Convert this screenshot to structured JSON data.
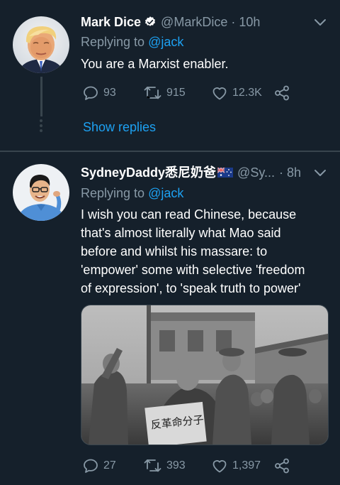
{
  "tweets": [
    {
      "name": "Mark Dice",
      "handle": "@MarkDice",
      "time": "· 10h",
      "replying_prefix": "Replying to",
      "replying_to": "@jack",
      "text": "You are a Marxist enabler.",
      "stats": {
        "replies": "93",
        "retweets": "915",
        "likes": "12.3K"
      },
      "show_replies": "Show replies",
      "verified": true
    },
    {
      "name": "SydneyDaddy悉尼奶爸",
      "handle": "@Sy...",
      "time": "· 8h",
      "replying_prefix": "Replying to",
      "replying_to": "@jack",
      "text_lines": [
        "I wish you can read Chinese, because",
        "that's almost literally what Mao said",
        "before and whilst his massare: to",
        "'empower' some with selective 'freedom",
        "of expression', to 'speak truth to power'"
      ],
      "stats": {
        "replies": "27",
        "retweets": "393",
        "likes": "1,397"
      },
      "image_sign_text": "反革命分子"
    }
  ],
  "icons": {
    "reply": "reply-icon",
    "retweet": "retweet-icon",
    "like": "heart-icon",
    "share": "share-icon",
    "caret": "chevron-down-icon",
    "verified": "verified-badge-icon",
    "flag": "australia-flag-icon"
  },
  "colors": {
    "background": "#15202b",
    "text": "#ffffff",
    "muted": "#8899a6",
    "link": "#1da1f2",
    "divider": "#38444d"
  }
}
